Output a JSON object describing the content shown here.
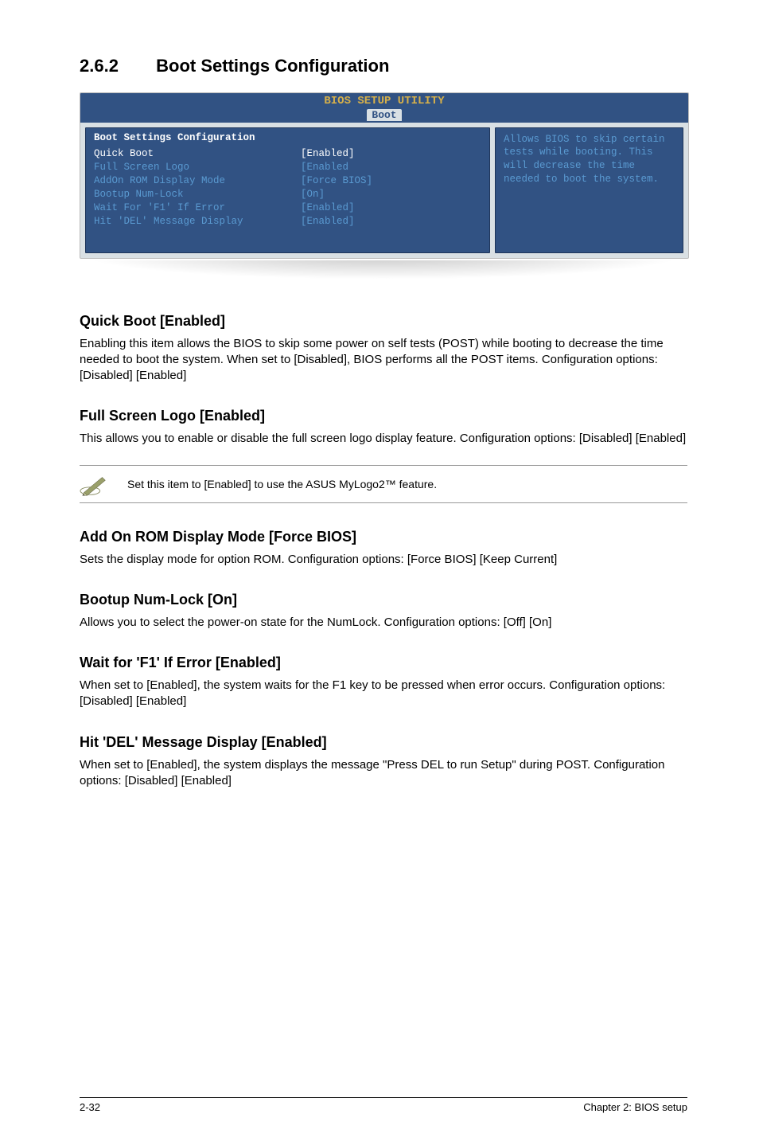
{
  "section": {
    "number": "2.6.2",
    "title": "Boot Settings Configuration"
  },
  "bios": {
    "utility_title": "BIOS SETUP UTILITY",
    "tab": "Boot",
    "panel_title": "Boot Settings Configuration",
    "rows": [
      {
        "label": "Quick Boot",
        "value": "[Enabled]",
        "selected": true
      },
      {
        "label": "Full Screen Logo",
        "value": "[Enabled",
        "selected": false
      },
      {
        "label": "AddOn ROM Display Mode",
        "value": "[Force BIOS]",
        "selected": false
      },
      {
        "label": "Bootup Num-Lock",
        "value": "[On]",
        "selected": false
      },
      {
        "label": "Wait For 'F1' If Error",
        "value": "[Enabled]",
        "selected": false
      },
      {
        "label": "Hit 'DEL' Message Display",
        "value": "[Enabled]",
        "selected": false
      }
    ],
    "help": "Allows BIOS to skip certain tests while booting. This will decrease the time needed to boot the system."
  },
  "items": {
    "quick_boot": {
      "heading": "Quick Boot [Enabled]",
      "text": "Enabling this item allows the BIOS to skip some power on self tests (POST) while booting to decrease the time needed to boot the system. When set to [Disabled], BIOS performs all the POST items. Configuration options: [Disabled] [Enabled]"
    },
    "full_screen_logo": {
      "heading": "Full Screen Logo [Enabled]",
      "text": "This allows you to enable or disable the full screen logo display feature. Configuration options: [Disabled] [Enabled]"
    },
    "note": "Set this item to [Enabled] to use the ASUS MyLogo2™ feature.",
    "addon_rom": {
      "heading": "Add On ROM Display Mode [Force BIOS]",
      "text": "Sets the display mode for option ROM. Configuration options: [Force BIOS] [Keep Current]"
    },
    "bootup_numlock": {
      "heading": "Bootup Num-Lock [On]",
      "text": "Allows you to select the power-on state for the NumLock. Configuration options: [Off] [On]"
    },
    "wait_f1": {
      "heading": "Wait for 'F1' If Error [Enabled]",
      "text": "When set to [Enabled], the system waits for the F1 key to be pressed when error occurs. Configuration options: [Disabled] [Enabled]"
    },
    "hit_del": {
      "heading": "Hit 'DEL' Message Display [Enabled]",
      "text": "When set to [Enabled], the system displays the message \"Press DEL to run Setup\" during POST. Configuration options: [Disabled] [Enabled]"
    }
  },
  "footer": {
    "left": "2-32",
    "right": "Chapter 2: BIOS setup"
  }
}
